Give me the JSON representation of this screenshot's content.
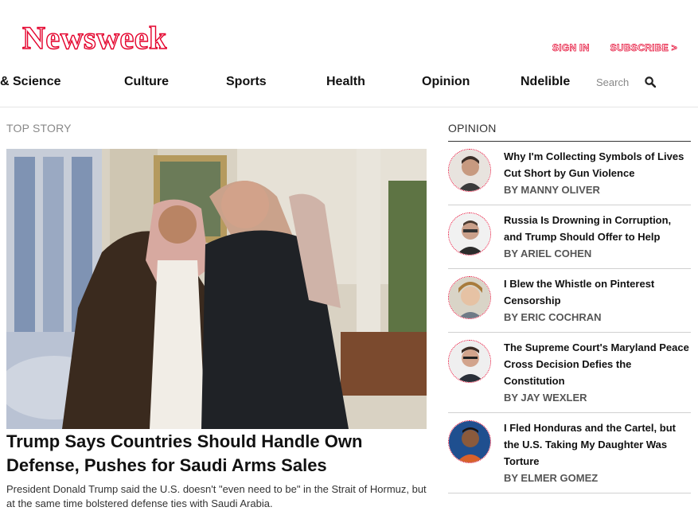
{
  "header": {
    "logo": "Newsweek",
    "sign_in": "SIGN IN",
    "subscribe": "SUBSCRIBE >"
  },
  "nav": {
    "items": [
      "& Science",
      "Culture",
      "Sports",
      "Health",
      "Opinion",
      "Ndelible"
    ],
    "search_placeholder": "Search"
  },
  "top_story": {
    "label": "TOP STORY",
    "headline": "Trump Says Countries Should Handle Own Defense, Pushes for Saudi Arms Sales",
    "dek": "President Donald Trump said the U.S. doesn't \"even need to be\" in the Strait of Hormuz, but at the same time bolstered defense ties with Saudi Arabia."
  },
  "opinion": {
    "label": "OPINION",
    "items": [
      {
        "title": "Why I'm Collecting Symbols of Lives Cut Short by Gun Violence",
        "author": "BY MANNY OLIVER"
      },
      {
        "title": "Russia Is Drowning in Corruption, and Trump Should Offer to Help",
        "author": "BY ARIEL COHEN"
      },
      {
        "title": "I Blew the Whistle on Pinterest Censorship",
        "author": "BY ERIC COCHRAN"
      },
      {
        "title": "The Supreme Court's Maryland Peace Cross Decision Defies the Constitution",
        "author": "BY JAY WEXLER"
      },
      {
        "title": "I Fled Honduras and the Cartel, but the U.S. Taking My Daughter Was Torture",
        "author": "BY ELMER GOMEZ"
      }
    ]
  }
}
